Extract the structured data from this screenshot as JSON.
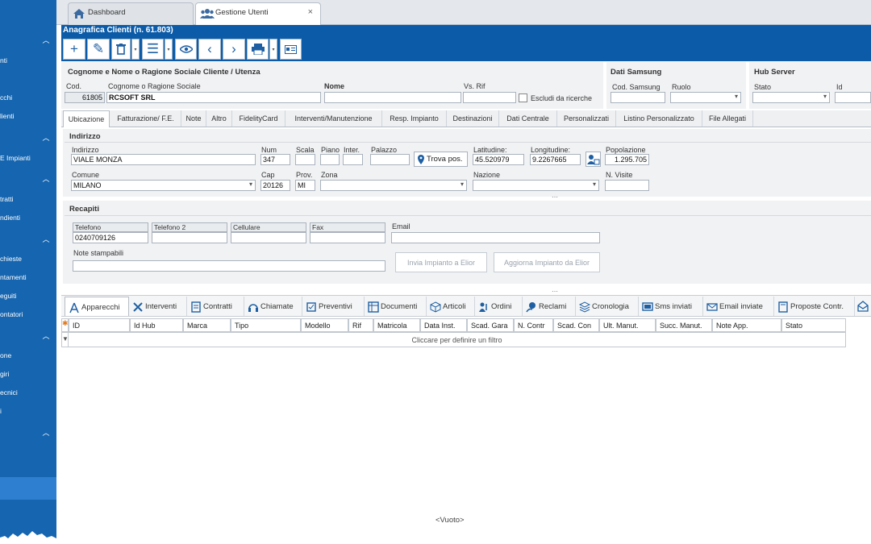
{
  "sidebar": {
    "items": [
      "nti",
      "cchi",
      "lienti",
      "E Impianti",
      "tratti",
      "ndienti",
      "chieste",
      "ntamenti",
      "eguiti",
      "ontatori",
      "one",
      "giri",
      "ecnici",
      "i"
    ]
  },
  "tabs": [
    {
      "label": "Dashboard",
      "icon": "home-icon"
    },
    {
      "label": "Gestione Utenti",
      "icon": "users-icon",
      "close": "×"
    }
  ],
  "form_title": "Anagrafica Clienti (n. 61.803)",
  "toolbar": {
    "buttons": [
      "add-icon",
      "edit-icon",
      "delete-icon",
      "list-icon",
      "view-icon",
      "prev-icon",
      "next-icon",
      "print-icon",
      "card-icon"
    ]
  },
  "header": {
    "section_title": "Cognome e Nome o Ragione Sociale Cliente / Utenza",
    "cod_label": "Cod.",
    "cod_value": "61805",
    "ragione_label": "Cognome o Ragione Sociale",
    "ragione_value": "RCSOFT SRL",
    "nome_label": "Nome",
    "nome_value": "",
    "vsrif_label": "Vs. Rif",
    "vsrif_value": "",
    "escludi_label": "Escludi da ricerche"
  },
  "samsung": {
    "title": "Dati Samsung",
    "cod_label": "Cod. Samsung",
    "ruolo_label": "Ruolo"
  },
  "hub": {
    "title": "Hub Server",
    "stato_label": "Stato",
    "id_label": "Id"
  },
  "subtabs": [
    "Ubicazione",
    "Fatturazione/ F.E.",
    "Note",
    "Altro",
    "FidelityCard",
    "Interventi/Manutenzione",
    "Resp. Impianto",
    "Destinazioni",
    "Dati Centrale",
    "Personalizzati",
    "Listino Personalizzato",
    "File Allegati"
  ],
  "indirizzo": {
    "title": "Indirizzo",
    "indirizzo_label": "Indirizzo",
    "indirizzo_value": "VIALE MONZA",
    "num_label": "Num",
    "num_value": "347",
    "scala_label": "Scala",
    "piano_label": "Piano",
    "inter_label": "Inter.",
    "palazzo_label": "Palazzo",
    "trova_label": "Trova pos.",
    "lat_label": "Latitudine:",
    "lat_value": "45.520979",
    "lon_label": "Longitudine:",
    "lon_value": "9.2267665",
    "pop_label": "Popolazione",
    "pop_value": "1.295.705",
    "comune_label": "Comune",
    "comune_value": "MILANO",
    "cap_label": "Cap",
    "cap_value": "20126",
    "prov_label": "Prov.",
    "prov_value": "MI",
    "zona_label": "Zona",
    "nazione_label": "Nazione",
    "visite_label": "N. Visite"
  },
  "recapiti": {
    "title": "Recapiti",
    "telefono_label": "Telefono",
    "telefono_value": "0240709126",
    "telefono2_label": "Telefono 2",
    "cellulare_label": "Cellulare",
    "fax_label": "Fax",
    "email_label": "Email",
    "note_label": "Note stampabili",
    "invia_btn": "Invia Impianto a Elior",
    "aggiorna_btn": "Aggiorna Impianto da Elior"
  },
  "bottom_tabs": [
    "Apparecchi",
    "Interventi",
    "Contratti",
    "Chiamate",
    "Preventivi",
    "Documenti",
    "Articoli",
    "Ordini",
    "Reclami",
    "Cronologia",
    "Sms inviati",
    "Email inviate",
    "Proposte Contr."
  ],
  "grid": {
    "columns": [
      "ID",
      "Id Hub",
      "Marca",
      "Tipo",
      "Modello",
      "Rif",
      "Matricola",
      "Data Inst.",
      "Scad. Gara",
      "N. Contr",
      "Scad. Con",
      "Ult. Manut.",
      "Succ. Manut.",
      "Note App.",
      "Stato"
    ],
    "filter_hint": "Cliccare per definire un filtro",
    "empty": "<Vuoto>"
  }
}
